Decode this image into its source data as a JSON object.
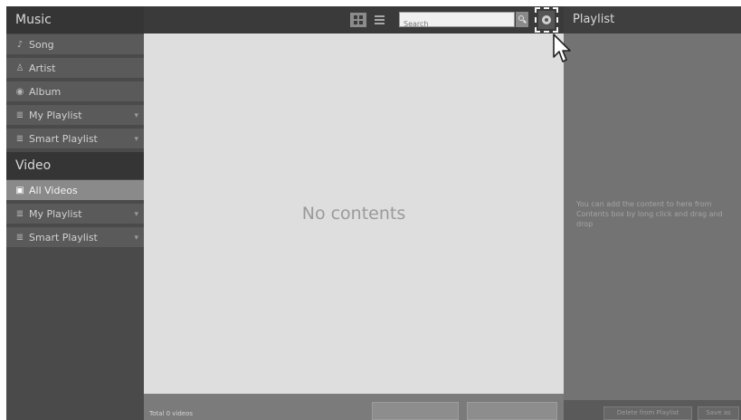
{
  "sidebar": {
    "music_header": "Music",
    "music_items": [
      {
        "label": "Song",
        "icon": "music-note-icon"
      },
      {
        "label": "Artist",
        "icon": "person-icon"
      },
      {
        "label": "Album",
        "icon": "disc-icon"
      },
      {
        "label": "My Playlist",
        "icon": "playlist-icon"
      },
      {
        "label": "Smart Playlist",
        "icon": "smart-playlist-icon"
      }
    ],
    "video_header": "Video",
    "video_items": [
      {
        "label": "All Videos",
        "icon": "film-icon",
        "selected": true
      },
      {
        "label": "My Playlist",
        "icon": "playlist-icon"
      },
      {
        "label": "Smart Playlist",
        "icon": "smart-playlist-icon"
      }
    ]
  },
  "toolbar": {
    "search_placeholder": "Search"
  },
  "content": {
    "empty_text": "No contents"
  },
  "bottom": {
    "total_label": "Total 0 videos"
  },
  "playlist": {
    "title": "Playlist",
    "hint": "You can add the content to here from Contents box by long click and drag and drop",
    "button_1": "Delete from Playlist",
    "button_2": "Save as"
  },
  "colors": {
    "sidebar_bg": "#4a4a4a",
    "selected_item": "#8a8a8a",
    "content_bg": "#dedede",
    "playlist_bg": "#737373"
  }
}
